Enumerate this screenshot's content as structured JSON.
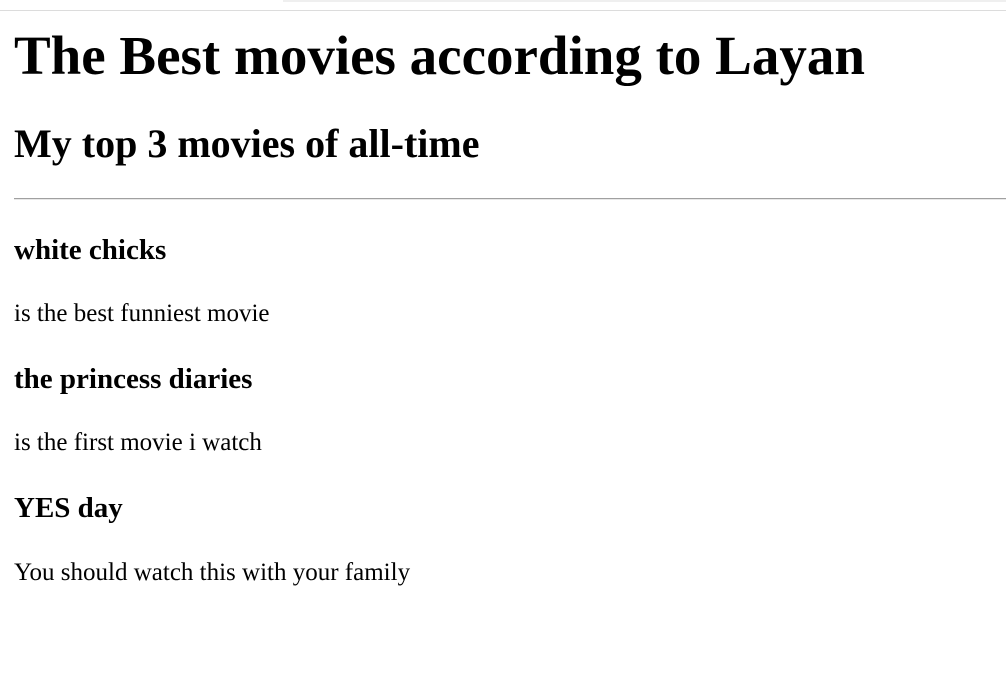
{
  "page": {
    "title": "The Best movies according to Layan",
    "subtitle": "My top 3 movies of all-time"
  },
  "movies": [
    {
      "title": "white chicks",
      "description": "is the best funniest movie"
    },
    {
      "title": "the princess diaries",
      "description": "is the first movie i watch"
    },
    {
      "title": "YES day",
      "description": "You should watch this with your family"
    }
  ]
}
